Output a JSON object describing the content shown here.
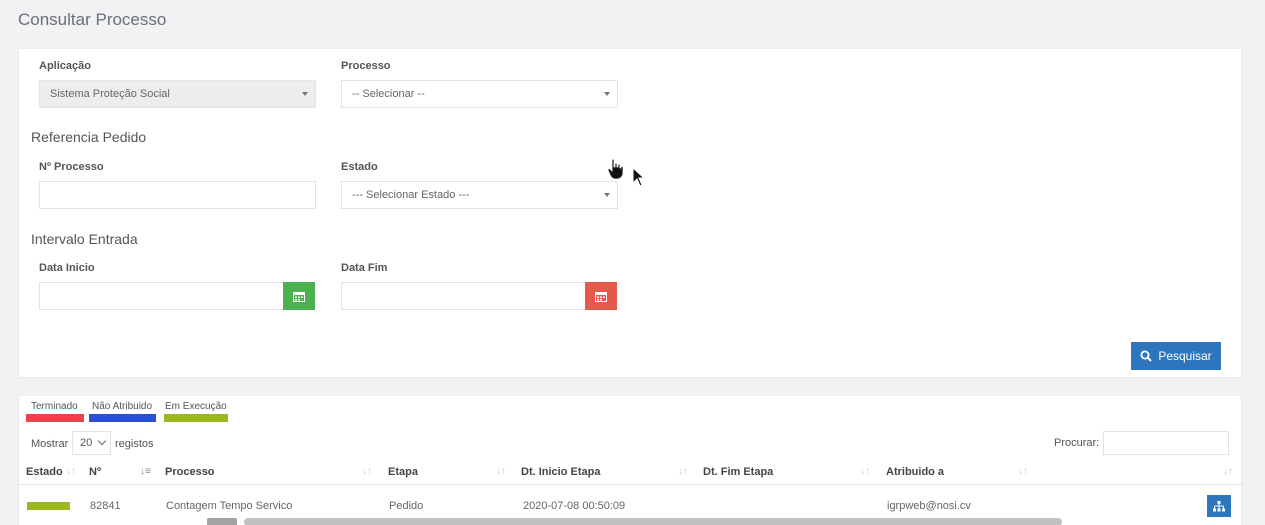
{
  "page": {
    "title": "Consultar Processo"
  },
  "form": {
    "aplicacao": {
      "label": "Aplicação",
      "value": "Sistema Proteção Social"
    },
    "processo": {
      "label": "Processo",
      "value": "-- Selecionar --"
    },
    "referencia_title": "Referencia Pedido",
    "num_processo": {
      "label": "Nº Processo",
      "value": ""
    },
    "estado": {
      "label": "Estado",
      "value": "--- Selecionar Estado ---"
    },
    "intervalo_title": "Intervalo Entrada",
    "data_inicio": {
      "label": "Data Inicio",
      "value": ""
    },
    "data_fim": {
      "label": "Data Fim",
      "value": ""
    },
    "search_button": "Pesquisar"
  },
  "legend": [
    {
      "label": "Terminado",
      "color": "#e8424f"
    },
    {
      "label": "Não Atribuido",
      "color": "#2a4fd8"
    },
    {
      "label": "Em Execução",
      "color": "#9ab91f"
    }
  ],
  "table": {
    "show_label": "Mostrar",
    "show_value": "20",
    "records_label": "registos",
    "search_label": "Procurar:",
    "columns": [
      "Estado",
      "Nº",
      "Processo",
      "Etapa",
      "Dt. Inicio Etapa",
      "Dt. Fim Etapa",
      "Atribuido a"
    ],
    "rows": [
      {
        "estado_color": "#9ab91f",
        "numero": "82841",
        "processo": "Contagem Tempo Servico",
        "etapa": "Pedido",
        "dt_inicio": "2020-07-08 00:50:09",
        "dt_fim": "",
        "atribuido": "igrpweb@nosi.cv"
      }
    ]
  },
  "colors": {
    "primary": "#2d76bd",
    "calendar_start": "#4caf50",
    "calendar_end": "#e35a4a"
  }
}
